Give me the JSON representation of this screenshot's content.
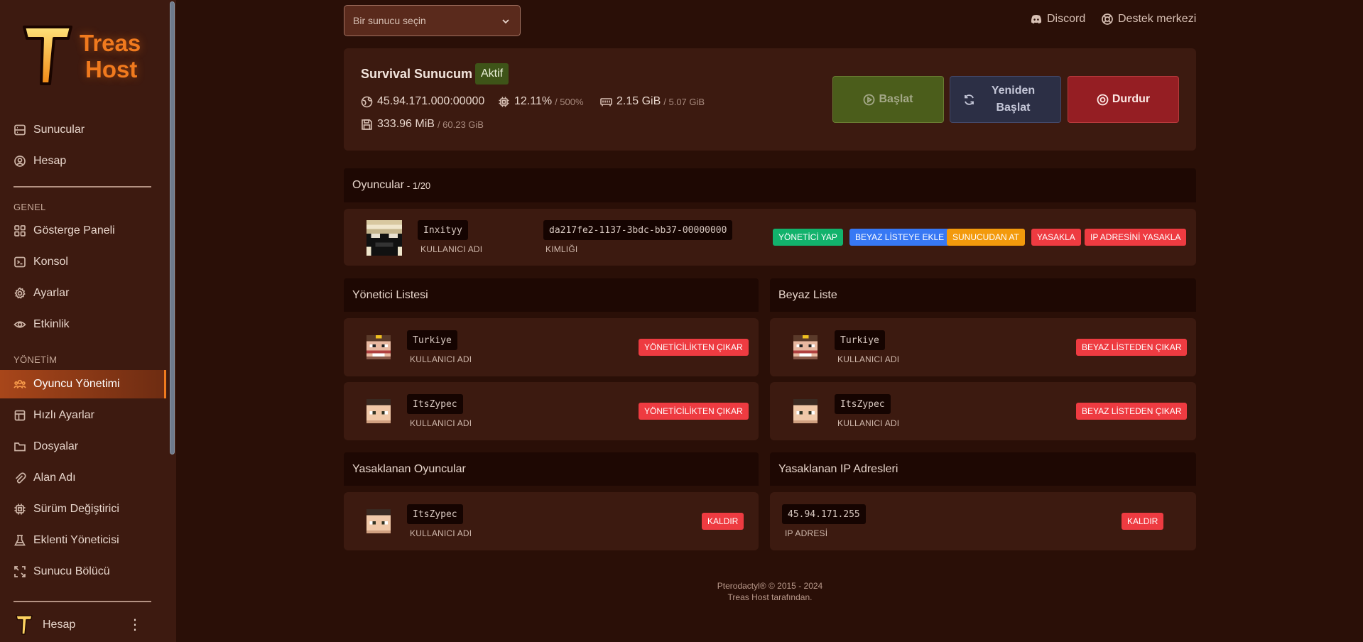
{
  "brand": {
    "line1": "Treas",
    "line2": "Host"
  },
  "sidebar": {
    "top_items": [
      {
        "label": "Sunucular",
        "icon": "server-icon"
      },
      {
        "label": "Hesap",
        "icon": "user-circle-icon"
      }
    ],
    "section_genel": "GENEL",
    "genel_items": [
      {
        "label": "Gösterge Paneli",
        "icon": "grid-icon"
      },
      {
        "label": "Konsol",
        "icon": "terminal-icon"
      },
      {
        "label": "Ayarlar",
        "icon": "gear-icon"
      },
      {
        "label": "Etkinlik",
        "icon": "eye-icon"
      }
    ],
    "section_yonetim": "YÖNETİM",
    "yonetim_items": [
      {
        "label": "Oyuncu Yönetimi",
        "icon": "users-icon",
        "active": true
      },
      {
        "label": "Hızlı Ayarlar",
        "icon": "sliders-icon"
      },
      {
        "label": "Dosyalar",
        "icon": "folder-icon"
      },
      {
        "label": "Alan Adı",
        "icon": "paperclip-icon"
      },
      {
        "label": "Sürüm Değiştirici",
        "icon": "chip-icon"
      },
      {
        "label": "Eklenti Yöneticisi",
        "icon": "flask-icon"
      },
      {
        "label": "Sunucu Bölücü",
        "icon": "split-icon"
      }
    ],
    "footer_label": "Hesap"
  },
  "top": {
    "select_placeholder": "Bir sunucu seçin",
    "discord": "Discord",
    "support": "Destek merkezi"
  },
  "server": {
    "name": "Survival Sunucum",
    "status": "Aktif",
    "address": "45.94.171.000:00000",
    "cpu": "12.11%",
    "cpu_limit": "/ 500%",
    "memory": "2.15 GiB",
    "memory_limit": "/ 5.07 GiB",
    "disk": "333.96 MiB",
    "disk_limit": "/ 60.23 GiB",
    "start": "Başlat",
    "restart_line1": "Yeniden",
    "restart_line2": "Başlat",
    "stop": "Durdur"
  },
  "players": {
    "title": "Oyuncular",
    "count": "- 1/20",
    "rows": [
      {
        "username": "Inxityy",
        "username_caption": "KULLANICI ADI",
        "uuid": "da217fe2-1137-3bdc-bb37-00000000",
        "uuid_caption": "KIMLIĞI",
        "actions": [
          "YÖNETİCİ YAP",
          "BEYAZ LİSTEYE EKLE",
          "SUNUCUDAN AT",
          "YASAKLA",
          "IP ADRESİNİ YASAKLA"
        ]
      }
    ]
  },
  "ops": {
    "title": "Yönetici Listesi",
    "rows": [
      {
        "username": "Turkiye",
        "caption": "KULLANICI ADI",
        "action": "YÖNETİCİLİKTEN ÇIKAR"
      },
      {
        "username": "ItsZypec",
        "caption": "KULLANICI ADI",
        "action": "YÖNETİCİLİKTEN ÇIKAR"
      }
    ]
  },
  "whitelist": {
    "title": "Beyaz Liste",
    "rows": [
      {
        "username": "Turkiye",
        "caption": "KULLANICI ADI",
        "action": "BEYAZ LİSTEDEN ÇIKAR"
      },
      {
        "username": "ItsZypec",
        "caption": "KULLANICI ADI",
        "action": "BEYAZ LİSTEDEN ÇIKAR"
      }
    ]
  },
  "banned_players": {
    "title": "Yasaklanan Oyuncular",
    "rows": [
      {
        "username": "ItsZypec",
        "caption": "KULLANICI ADI",
        "action": "KALDIR"
      }
    ]
  },
  "banned_ips": {
    "title": "Yasaklanan IP Adresleri",
    "rows": [
      {
        "ip": "45.94.171.255",
        "caption": "IP ADRESİ",
        "action": "KALDIR"
      }
    ]
  },
  "footer": {
    "line1": "Pterodactyl® © 2015 - 2024",
    "line2": "Treas Host tarafından."
  },
  "colors": {
    "background": "#2a0f07",
    "sidebar": "#3d1a10",
    "accent": "#f07a1e",
    "danger": "#ee3b41",
    "success": "#12b26c",
    "info": "#3778f4",
    "warning": "#f39a0c"
  }
}
